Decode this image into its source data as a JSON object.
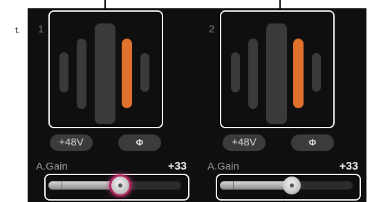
{
  "margin_note": "t.",
  "channels": [
    {
      "number": "1",
      "phantom_label": "+48V",
      "phase_label": "Φ",
      "gain_label": "A.Gain",
      "gain_value": "+33",
      "gain_slider_fraction": 0.54,
      "slider_focused": true,
      "active_meter_index": 3
    },
    {
      "number": "2",
      "phantom_label": "+48V",
      "phase_label": "Φ",
      "gain_label": "A.Gain",
      "gain_value": "+33",
      "gain_slider_fraction": 0.54,
      "slider_focused": false,
      "active_meter_index": 3
    }
  ],
  "colors": {
    "panel_bg": "#0f0f10",
    "meter_idle": "#3a3a3c",
    "meter_active": "#e0722d",
    "highlight_frame": "#ffffff",
    "focus_glow": "#c33a73"
  }
}
